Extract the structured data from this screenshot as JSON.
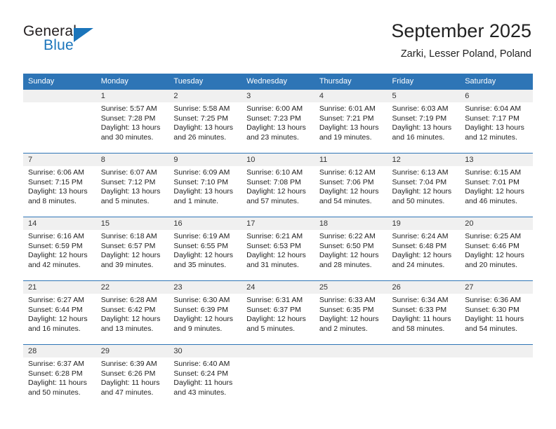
{
  "logo": {
    "word1": "General",
    "word2": "Blue",
    "triangle_color": "#1b75bb"
  },
  "header": {
    "title": "September 2025",
    "location": "Zarki, Lesser Poland, Poland"
  },
  "theme": {
    "header_blue": "#2e75b6",
    "daynum_gray": "#f0f0f0",
    "text": "#222222"
  },
  "weekdays": [
    "Sunday",
    "Monday",
    "Tuesday",
    "Wednesday",
    "Thursday",
    "Friday",
    "Saturday"
  ],
  "weeks": [
    [
      {
        "day": ""
      },
      {
        "day": "1",
        "sunrise": "Sunrise: 5:57 AM",
        "sunset": "Sunset: 7:28 PM",
        "daylight": "Daylight: 13 hours and 30 minutes."
      },
      {
        "day": "2",
        "sunrise": "Sunrise: 5:58 AM",
        "sunset": "Sunset: 7:25 PM",
        "daylight": "Daylight: 13 hours and 26 minutes."
      },
      {
        "day": "3",
        "sunrise": "Sunrise: 6:00 AM",
        "sunset": "Sunset: 7:23 PM",
        "daylight": "Daylight: 13 hours and 23 minutes."
      },
      {
        "day": "4",
        "sunrise": "Sunrise: 6:01 AM",
        "sunset": "Sunset: 7:21 PM",
        "daylight": "Daylight: 13 hours and 19 minutes."
      },
      {
        "day": "5",
        "sunrise": "Sunrise: 6:03 AM",
        "sunset": "Sunset: 7:19 PM",
        "daylight": "Daylight: 13 hours and 16 minutes."
      },
      {
        "day": "6",
        "sunrise": "Sunrise: 6:04 AM",
        "sunset": "Sunset: 7:17 PM",
        "daylight": "Daylight: 13 hours and 12 minutes."
      }
    ],
    [
      {
        "day": "7",
        "sunrise": "Sunrise: 6:06 AM",
        "sunset": "Sunset: 7:15 PM",
        "daylight": "Daylight: 13 hours and 8 minutes."
      },
      {
        "day": "8",
        "sunrise": "Sunrise: 6:07 AM",
        "sunset": "Sunset: 7:12 PM",
        "daylight": "Daylight: 13 hours and 5 minutes."
      },
      {
        "day": "9",
        "sunrise": "Sunrise: 6:09 AM",
        "sunset": "Sunset: 7:10 PM",
        "daylight": "Daylight: 13 hours and 1 minute."
      },
      {
        "day": "10",
        "sunrise": "Sunrise: 6:10 AM",
        "sunset": "Sunset: 7:08 PM",
        "daylight": "Daylight: 12 hours and 57 minutes."
      },
      {
        "day": "11",
        "sunrise": "Sunrise: 6:12 AM",
        "sunset": "Sunset: 7:06 PM",
        "daylight": "Daylight: 12 hours and 54 minutes."
      },
      {
        "day": "12",
        "sunrise": "Sunrise: 6:13 AM",
        "sunset": "Sunset: 7:04 PM",
        "daylight": "Daylight: 12 hours and 50 minutes."
      },
      {
        "day": "13",
        "sunrise": "Sunrise: 6:15 AM",
        "sunset": "Sunset: 7:01 PM",
        "daylight": "Daylight: 12 hours and 46 minutes."
      }
    ],
    [
      {
        "day": "14",
        "sunrise": "Sunrise: 6:16 AM",
        "sunset": "Sunset: 6:59 PM",
        "daylight": "Daylight: 12 hours and 42 minutes."
      },
      {
        "day": "15",
        "sunrise": "Sunrise: 6:18 AM",
        "sunset": "Sunset: 6:57 PM",
        "daylight": "Daylight: 12 hours and 39 minutes."
      },
      {
        "day": "16",
        "sunrise": "Sunrise: 6:19 AM",
        "sunset": "Sunset: 6:55 PM",
        "daylight": "Daylight: 12 hours and 35 minutes."
      },
      {
        "day": "17",
        "sunrise": "Sunrise: 6:21 AM",
        "sunset": "Sunset: 6:53 PM",
        "daylight": "Daylight: 12 hours and 31 minutes."
      },
      {
        "day": "18",
        "sunrise": "Sunrise: 6:22 AM",
        "sunset": "Sunset: 6:50 PM",
        "daylight": "Daylight: 12 hours and 28 minutes."
      },
      {
        "day": "19",
        "sunrise": "Sunrise: 6:24 AM",
        "sunset": "Sunset: 6:48 PM",
        "daylight": "Daylight: 12 hours and 24 minutes."
      },
      {
        "day": "20",
        "sunrise": "Sunrise: 6:25 AM",
        "sunset": "Sunset: 6:46 PM",
        "daylight": "Daylight: 12 hours and 20 minutes."
      }
    ],
    [
      {
        "day": "21",
        "sunrise": "Sunrise: 6:27 AM",
        "sunset": "Sunset: 6:44 PM",
        "daylight": "Daylight: 12 hours and 16 minutes."
      },
      {
        "day": "22",
        "sunrise": "Sunrise: 6:28 AM",
        "sunset": "Sunset: 6:42 PM",
        "daylight": "Daylight: 12 hours and 13 minutes."
      },
      {
        "day": "23",
        "sunrise": "Sunrise: 6:30 AM",
        "sunset": "Sunset: 6:39 PM",
        "daylight": "Daylight: 12 hours and 9 minutes."
      },
      {
        "day": "24",
        "sunrise": "Sunrise: 6:31 AM",
        "sunset": "Sunset: 6:37 PM",
        "daylight": "Daylight: 12 hours and 5 minutes."
      },
      {
        "day": "25",
        "sunrise": "Sunrise: 6:33 AM",
        "sunset": "Sunset: 6:35 PM",
        "daylight": "Daylight: 12 hours and 2 minutes."
      },
      {
        "day": "26",
        "sunrise": "Sunrise: 6:34 AM",
        "sunset": "Sunset: 6:33 PM",
        "daylight": "Daylight: 11 hours and 58 minutes."
      },
      {
        "day": "27",
        "sunrise": "Sunrise: 6:36 AM",
        "sunset": "Sunset: 6:30 PM",
        "daylight": "Daylight: 11 hours and 54 minutes."
      }
    ],
    [
      {
        "day": "28",
        "sunrise": "Sunrise: 6:37 AM",
        "sunset": "Sunset: 6:28 PM",
        "daylight": "Daylight: 11 hours and 50 minutes."
      },
      {
        "day": "29",
        "sunrise": "Sunrise: 6:39 AM",
        "sunset": "Sunset: 6:26 PM",
        "daylight": "Daylight: 11 hours and 47 minutes."
      },
      {
        "day": "30",
        "sunrise": "Sunrise: 6:40 AM",
        "sunset": "Sunset: 6:24 PM",
        "daylight": "Daylight: 11 hours and 43 minutes."
      },
      {
        "day": ""
      },
      {
        "day": ""
      },
      {
        "day": ""
      },
      {
        "day": ""
      }
    ]
  ]
}
